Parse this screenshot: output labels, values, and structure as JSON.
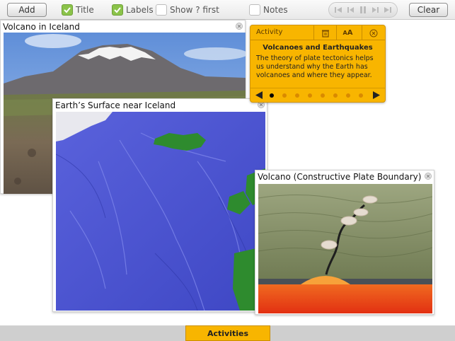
{
  "toolbar": {
    "add_label": "Add",
    "clear_label": "Clear",
    "checkboxes": [
      {
        "label": "Title",
        "checked": true
      },
      {
        "label": "Labels",
        "checked": true
      },
      {
        "label": "Show ? first",
        "checked": false
      },
      {
        "label": "Notes",
        "checked": false
      }
    ],
    "player_icons": [
      "skip-start-icon",
      "step-back-icon",
      "pause-icon",
      "step-forward-icon",
      "skip-end-icon"
    ]
  },
  "panels": [
    {
      "title": "Volcano in Iceland",
      "image": "volcano-photo"
    },
    {
      "title": "Earth’s Surface near Iceland",
      "image": "ocean-floor-map"
    },
    {
      "title": "Volcano (Constructive Plate Boundary)",
      "image": "plate-boundary-illustration"
    }
  ],
  "activity": {
    "label": "Activity",
    "font_label": "A",
    "title": "Volcanoes and Earthquakes",
    "body": "The theory of plate tectonics helps us understand why the Earth has volcanoes and where they appear.",
    "current_page": 1,
    "total_pages": 8
  },
  "bottom": {
    "tab_label": "Activities"
  },
  "colors": {
    "accent": "#f8b500",
    "check": "#8bc34a",
    "ocean": "#4a55d4",
    "land": "#2e8b2e"
  }
}
